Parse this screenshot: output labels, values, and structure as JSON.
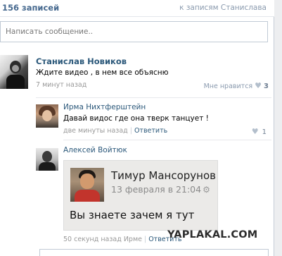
{
  "wall": {
    "records_count": "156 записей",
    "to_owner_posts": "к записям Станислава",
    "composer_placeholder": "Написать сообщение.."
  },
  "post": {
    "author": "Станислав Новиков",
    "text": "Ждите видео , в нем все объясню",
    "time": "7 минут назад",
    "like_label": "Мне нравится",
    "like_count": "3"
  },
  "comments": [
    {
      "author": "Ирма Нихтферштейн",
      "text": "Давай видос где она тверк танцует !",
      "time": "две минуты назад",
      "reply_label": "Ответить",
      "like_count": "1"
    },
    {
      "author": "Алексей Войтюк",
      "time": "50 секунд назад Ирме",
      "reply_label": "Ответить",
      "attachment": {
        "name": "Тимур Мансорунов",
        "date": "13 февраля в 21:04",
        "message": "Вы знаете зачем я тут"
      }
    }
  ],
  "watermark": "YAPLAKAL.COM",
  "icons": {
    "heart": "heart-icon",
    "gear": "gear-icon"
  },
  "colors": {
    "link": "#2b587a",
    "header_link": "#45688e",
    "meta": "#999999"
  }
}
